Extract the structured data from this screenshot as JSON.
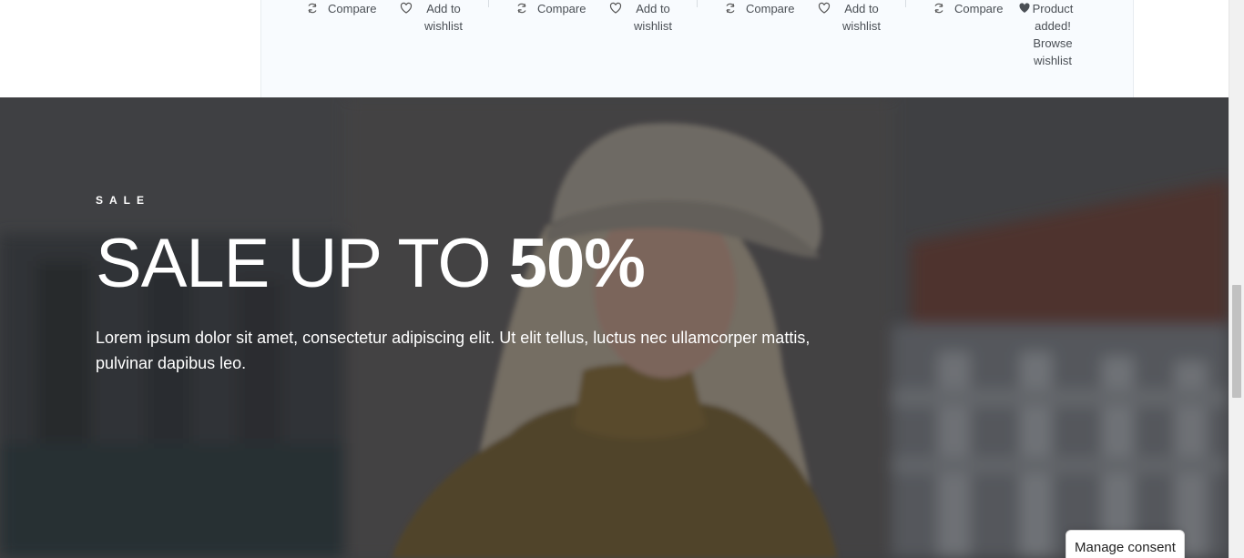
{
  "product_actions": [
    {
      "compare_label": "Compare",
      "wishlist_label": "Add to wishlist",
      "wishlist_state": "add"
    },
    {
      "compare_label": "Compare",
      "wishlist_label": "Add to wishlist",
      "wishlist_state": "add"
    },
    {
      "compare_label": "Compare",
      "wishlist_label": "Add to wishlist",
      "wishlist_state": "add"
    },
    {
      "compare_label": "Compare",
      "wishlist_label": "Product added! Browse wishlist",
      "wishlist_state": "added"
    }
  ],
  "hero": {
    "eyebrow": "SALE",
    "headline_light": "SALE UP TO ",
    "headline_bold": "50%",
    "description": "Lorem ipsum dolor sit amet, consectetur adipiscing elit. Ut elit tellus, luctus nec ullamcorper mattis, pulvinar dapibus leo."
  },
  "consent": {
    "label": "Manage consent"
  },
  "colors": {
    "text_dark": "#4a4f55",
    "panel_bg": "#f8fbfe",
    "hero_text": "#ffffff"
  },
  "icons": {
    "compare": "refresh-icon",
    "wishlist": "heart-outline-icon",
    "wishlist_added": "heart-filled-icon"
  }
}
